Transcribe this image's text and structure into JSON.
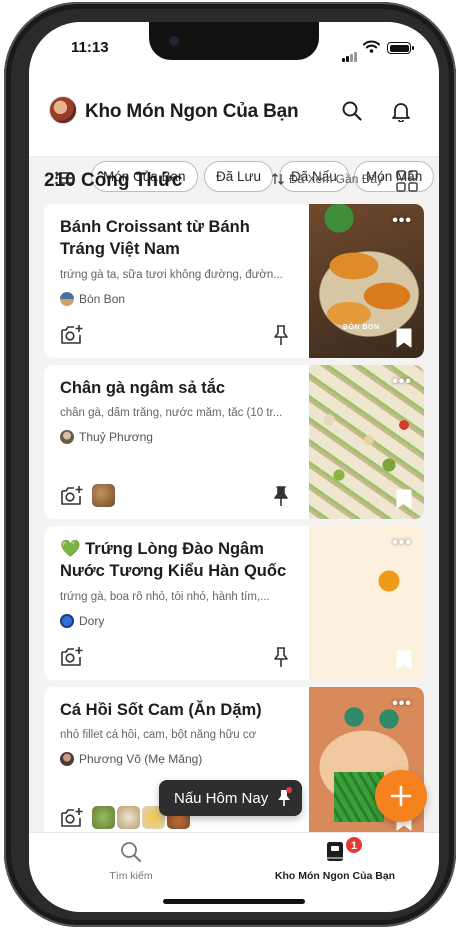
{
  "status": {
    "time": "11:13"
  },
  "header": {
    "title": "Kho Món Ngon Của Bạn"
  },
  "filters": [
    "Món Của Bạn",
    "Đã Lưu",
    "Đã Nấu",
    "Món Mặn"
  ],
  "list": {
    "count_label": "210 Công Thức",
    "sort_label": "Đã Xem Gần Đây"
  },
  "recipes": [
    {
      "title": "Bánh Croissant từ Bánh Tráng Việt Nam",
      "ingredients": "trứng gà ta, sữa tươi không đường, đườn...",
      "author": "Bòn Bon",
      "photo_caption": "BÒN BON"
    },
    {
      "title": "Chân gà ngâm sả tắc",
      "ingredients": "chân gà, dấm trắng, nước mắm, tắc (10 tr...",
      "author": "Thuỷ Phương"
    },
    {
      "title": "💚 Trứng Lòng Đào Ngâm Nước Tương Kiểu Hàn Quốc",
      "ingredients": "trứng gà, boa rô nhỏ, tỏi nhỏ, hành tím,...",
      "author": "Dory"
    },
    {
      "title": "Cá Hồi Sốt Cam (Ăn Dặm)",
      "ingredients": "nhỏ fillet cá hồi, cam, bột năng hữu cơ",
      "author": "Phương Võ (Mẹ Măng)"
    }
  ],
  "cook_today": {
    "label": "Nấu Hôm Nay"
  },
  "tabbar": {
    "search_label": "Tìm kiếm",
    "library_label": "Kho Món Ngon Của Bạn",
    "library_badge": "1"
  },
  "colors": {
    "accent": "#f5811f",
    "badge": "#e53935"
  }
}
